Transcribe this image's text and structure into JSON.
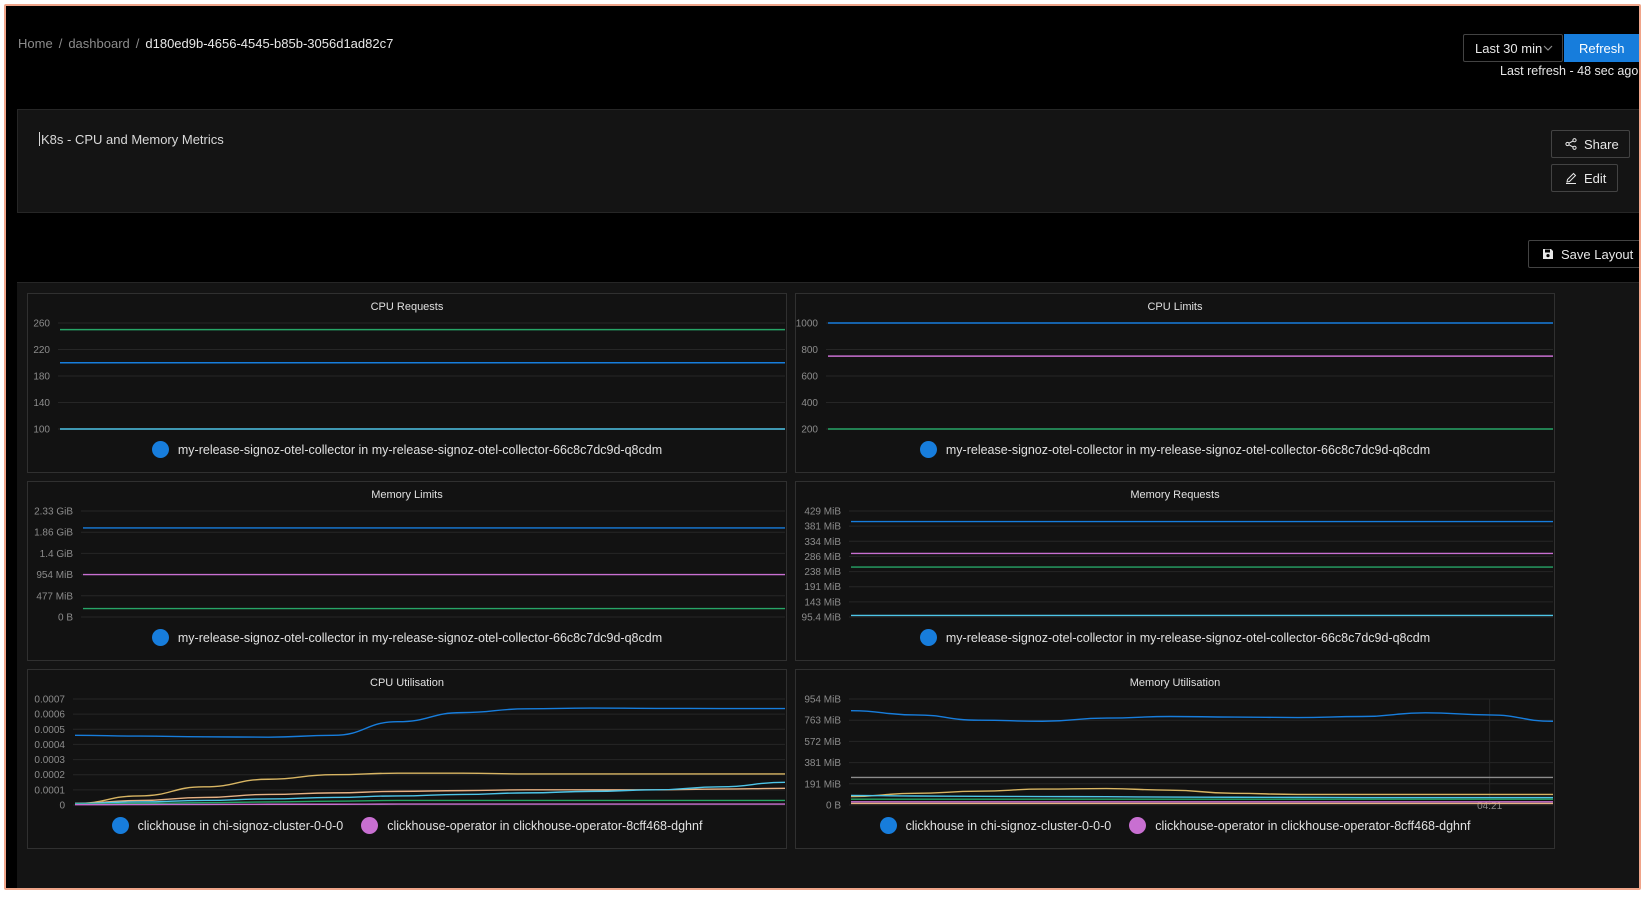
{
  "breadcrumb": {
    "home": "Home",
    "dashboard": "dashboard",
    "id": "d180ed9b-4656-4545-b85b-3056d1ad82c7",
    "separator": "/"
  },
  "header": {
    "time_range": "Last 30 min",
    "refresh_label": "Refresh",
    "last_refresh": "Last refresh - 48 sec ago"
  },
  "dashboard": {
    "title": "K8s - CPU and Memory Metrics",
    "share_label": "Share",
    "edit_label": "Edit",
    "save_layout_label": "Save Layout"
  },
  "colors": {
    "blue": "#177ddc",
    "violet": "#c86fd1",
    "green": "#27a567",
    "cyan": "#4ec5e8",
    "yellow": "#d8b563",
    "peach": "#e6b184",
    "accent": "#177ddc"
  },
  "widgets": [
    {
      "title": "CPU Requests",
      "chart_data": {
        "type": "line",
        "yticks": [
          "260",
          "220",
          "180",
          "140",
          "100"
        ],
        "ylim": [
          100,
          260
        ],
        "series": [
          {
            "color_key": "green",
            "values": [
              250,
              250,
              250
            ]
          },
          {
            "color_key": "blue",
            "values": [
              200,
              200,
              200
            ]
          },
          {
            "color_key": "cyan",
            "values": [
              100,
              100,
              100
            ]
          }
        ]
      },
      "legend": [
        {
          "label": "my-release-signoz-otel-collector in my-release-signoz-otel-collector-66c8c7dc9d-q8cdm",
          "color": "#177ddc"
        }
      ]
    },
    {
      "title": "CPU Limits",
      "chart_data": {
        "type": "line",
        "yticks": [
          "1000",
          "800",
          "600",
          "400",
          "200"
        ],
        "ylim": [
          200,
          1000
        ],
        "series": [
          {
            "color_key": "blue",
            "values": [
              1000,
              1000,
              1000
            ]
          },
          {
            "color_key": "violet",
            "values": [
              750,
              750,
              750
            ]
          },
          {
            "color_key": "green",
            "values": [
              200,
              200,
              200
            ]
          }
        ]
      },
      "legend": [
        {
          "label": "my-release-signoz-otel-collector in my-release-signoz-otel-collector-66c8c7dc9d-q8cdm",
          "color": "#177ddc"
        }
      ]
    },
    {
      "title": "Memory Limits",
      "chart_data": {
        "type": "line",
        "yticks": [
          "2.33 GiB",
          "1.86 GiB",
          "1.4 GiB",
          "954 MiB",
          "477 MiB",
          "0 B"
        ],
        "ylim": [
          0,
          5
        ],
        "series": [
          {
            "color_key": "blue",
            "values": [
              4.2,
              4.2,
              4.2
            ]
          },
          {
            "color_key": "violet",
            "values": [
              2.0,
              2.0,
              2.0
            ]
          },
          {
            "color_key": "green",
            "values": [
              0.4,
              0.4,
              0.4
            ]
          }
        ]
      },
      "legend": [
        {
          "label": "my-release-signoz-otel-collector in my-release-signoz-otel-collector-66c8c7dc9d-q8cdm",
          "color": "#177ddc"
        }
      ]
    },
    {
      "title": "Memory Requests",
      "chart_data": {
        "type": "line",
        "yticks": [
          "429 MiB",
          "381 MiB",
          "334 MiB",
          "286 MiB",
          "238 MiB",
          "191 MiB",
          "143 MiB",
          "95.4 MiB"
        ],
        "ylim": [
          0,
          7
        ],
        "series": [
          {
            "color_key": "blue",
            "values": [
              6.3,
              6.3,
              6.3
            ]
          },
          {
            "color_key": "violet",
            "values": [
              4.2,
              4.2,
              4.2
            ]
          },
          {
            "color_key": "green",
            "values": [
              3.3,
              3.3,
              3.3
            ]
          },
          {
            "color_key": "cyan",
            "values": [
              0.1,
              0.1,
              0.1
            ]
          }
        ]
      },
      "legend": [
        {
          "label": "my-release-signoz-otel-collector in my-release-signoz-otel-collector-66c8c7dc9d-q8cdm",
          "color": "#177ddc"
        }
      ]
    },
    {
      "title": "CPU Utilisation",
      "chart_data": {
        "type": "line",
        "yticks": [
          "0.0007",
          "0.0006",
          "0.0005",
          "0.0004",
          "0.0003",
          "0.0002",
          "0.0001",
          "0"
        ],
        "ylim": [
          0,
          0.0007
        ],
        "series": [
          {
            "color_key": "blue",
            "values": [
              0.00046,
              0.000455,
              0.00045,
              0.000448,
              0.00046,
              0.00055,
              0.00061,
              0.000635,
              0.00064,
              0.000638,
              0.000637,
              0.000637
            ]
          },
          {
            "color_key": "yellow",
            "values": [
              1e-05,
              6e-05,
              0.00012,
              0.00017,
              0.0002,
              0.00021,
              0.00021,
              0.000205,
              0.000205,
              0.000205,
              0.000205,
              0.000205
            ]
          },
          {
            "color_key": "peach",
            "values": [
              1e-05,
              3e-05,
              5e-05,
              7e-05,
              8e-05,
              9e-05,
              9.5e-05,
              0.0001,
              0.0001,
              0.0001,
              0.000105,
              0.00011
            ]
          },
          {
            "color_key": "cyan",
            "values": [
              1e-05,
              2e-05,
              3e-05,
              4e-05,
              5e-05,
              6e-05,
              7e-05,
              8e-05,
              9e-05,
              0.0001,
              0.00012,
              0.00015
            ]
          },
          {
            "color_key": "green",
            "values": [
              5e-06,
              1e-05,
              1.5e-05,
              2e-05,
              2.5e-05,
              3e-05,
              3e-05,
              3e-05,
              3e-05,
              3e-05,
              3e-05,
              3e-05
            ]
          },
          {
            "color_key": "violet",
            "values": [
              2e-06,
              3e-06,
              4e-06,
              5e-06,
              5e-06,
              6e-06,
              6e-06,
              6e-06,
              6e-06,
              6e-06,
              6e-06,
              6e-06
            ]
          }
        ]
      },
      "legend": [
        {
          "label": "clickhouse in chi-signoz-cluster-0-0-0",
          "color": "#177ddc"
        },
        {
          "label": "clickhouse-operator in clickhouse-operator-8cff468-dghnf",
          "color": "#c86fd1"
        }
      ]
    },
    {
      "title": "Memory Utilisation",
      "chart_data": {
        "type": "line",
        "yticks": [
          "954 MiB",
          "763 MiB",
          "572 MiB",
          "381 MiB",
          "191 MiB",
          "0 B"
        ],
        "ylim": [
          0,
          1000
        ],
        "xticks": [
          "04:21"
        ],
        "series": [
          {
            "color_key": "blue",
            "values": [
              890,
              850,
              800,
              790,
              820,
              835,
              830,
              825,
              835,
              870,
              850,
              790
            ]
          },
          {
            "color_key": "grey",
            "values": [
              260,
              260,
              260,
              260,
              260,
              260,
              260,
              260,
              260,
              260,
              260,
              260
            ]
          },
          {
            "color_key": "yellow",
            "values": [
              80,
              110,
              130,
              150,
              155,
              140,
              110,
              100,
              100,
              100,
              100,
              100
            ]
          },
          {
            "color_key": "cyan",
            "values": [
              90,
              85,
              82,
              80,
              78,
              75,
              73,
              72,
              70,
              70,
              70,
              70
            ]
          },
          {
            "color_key": "green",
            "values": [
              55,
              55,
              55,
              55,
              55,
              55,
              55,
              55,
              55,
              55,
              55,
              55
            ]
          },
          {
            "color_key": "violet",
            "values": [
              30,
              30,
              30,
              30,
              30,
              30,
              30,
              30,
              30,
              30,
              30,
              30
            ]
          },
          {
            "color_key": "peach",
            "values": [
              15,
              15,
              15,
              15,
              15,
              15,
              15,
              15,
              15,
              15,
              15,
              15
            ]
          }
        ]
      },
      "legend": [
        {
          "label": "clickhouse in chi-signoz-cluster-0-0-0",
          "color": "#177ddc"
        },
        {
          "label": "clickhouse-operator in clickhouse-operator-8cff468-dghnf",
          "color": "#c86fd1"
        }
      ]
    }
  ]
}
